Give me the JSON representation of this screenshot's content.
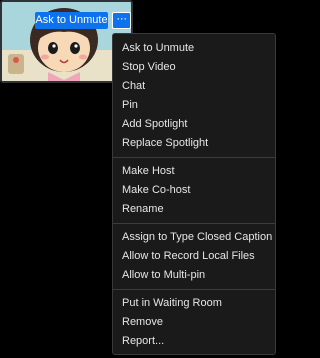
{
  "tile": {
    "ask_to_unmute_label": "Ask to Unmute",
    "more_label": "···"
  },
  "menu": {
    "group1": [
      {
        "label": "Ask to Unmute"
      },
      {
        "label": "Stop Video"
      },
      {
        "label": "Chat"
      },
      {
        "label": "Pin"
      },
      {
        "label": "Add Spotlight"
      },
      {
        "label": "Replace Spotlight"
      }
    ],
    "group2": [
      {
        "label": "Make Host"
      },
      {
        "label": "Make Co-host"
      },
      {
        "label": "Rename"
      }
    ],
    "group3": [
      {
        "label": "Assign to Type Closed Caption"
      },
      {
        "label": "Allow to Record Local Files"
      },
      {
        "label": "Allow to Multi-pin"
      }
    ],
    "group4": [
      {
        "label": "Put in Waiting Room"
      },
      {
        "label": "Remove"
      },
      {
        "label": "Report..."
      }
    ]
  },
  "colors": {
    "accent": "#0e72ed",
    "menu_bg": "#1a1a1a",
    "menu_text": "#e6e6e6"
  }
}
